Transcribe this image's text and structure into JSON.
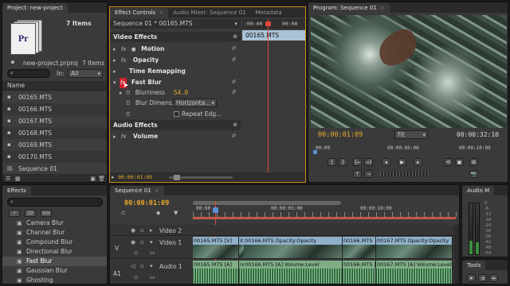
{
  "project": {
    "tab": "Project: new-project",
    "items_count": "7 Items",
    "filename": "new-project.prproj",
    "items_count2": "7 Items",
    "in_label": "In:",
    "in_value": "All",
    "name_header": "Name",
    "files": [
      "00165.MTS",
      "00166.MTS",
      "00167.MTS",
      "00168.MTS",
      "00169.MTS",
      "00170.MTS",
      "Sequence 01"
    ]
  },
  "effect_controls": {
    "tabs": [
      "Effect Controls",
      "Audio Mixer: Sequence 01",
      "Metadata"
    ],
    "header": "Sequence 01 * 00165.MTS",
    "video_effects": "Video Effects",
    "motion": "Motion",
    "opacity": "Opacity",
    "time_remapping": "Time Remapping",
    "fast_blur": "Fast Blur",
    "blurriness_label": "Blurriness",
    "blurriness_value": "54.0",
    "blur_dimensions_label": "Blur Dimens...",
    "blur_dimensions_value": "Horizonta...",
    "repeat_edge_label": "Repeat Edg...",
    "audio_effects": "Audio Effects",
    "volume": "Volume",
    "timeline_time": ":00:00",
    "timeline_time2": "00:00",
    "clip_label": "00165.MTS",
    "current_time": "00:00:01:09"
  },
  "program": {
    "tab": "Program: Sequence 01",
    "timecode": "00:00:01:09",
    "fit": "Fit",
    "duration": "00:00:32:10",
    "ruler": [
      "00:00",
      "00:00:05:00",
      "00:00:10:00"
    ]
  },
  "effects": {
    "tab": "Effects",
    "badges": [
      "32",
      "YUV"
    ],
    "items": [
      "Camera Blur",
      "Channel Blur",
      "Compound Blur",
      "Directional Blur",
      "Fast Blur",
      "Gaussian Blur",
      "Ghosting"
    ]
  },
  "timeline": {
    "tab": "Sequence 01",
    "timecode": "00:00:01:09",
    "ruler": [
      "00:00",
      "00:00:05:00",
      "00:00:10:00"
    ],
    "tracks": {
      "video2": "Video 2",
      "video1": "Video 1",
      "audio1": "Audio 1",
      "v_label": "V",
      "a1_label": "A1"
    },
    "video_clips": [
      "00165.MTS [V]",
      "ity",
      "00166.MTS  Opacity:Opacity",
      "00166.MTS",
      "00167.MTS  Opacity:Opacity"
    ],
    "audio_clips": [
      "00165.MTS [A]",
      "rel",
      "00166.MTS [A]  Volume:Level",
      "00166.MTS [A]",
      "00167.MTS [A]  Volume:Level"
    ]
  },
  "audio_meters": {
    "tab": "Audio M",
    "labels": [
      "0",
      "-6",
      "-12",
      "-18",
      "-24",
      "-30",
      "-36",
      "-42",
      "-48",
      "-54"
    ]
  },
  "tools": {
    "tab": "Tools"
  }
}
